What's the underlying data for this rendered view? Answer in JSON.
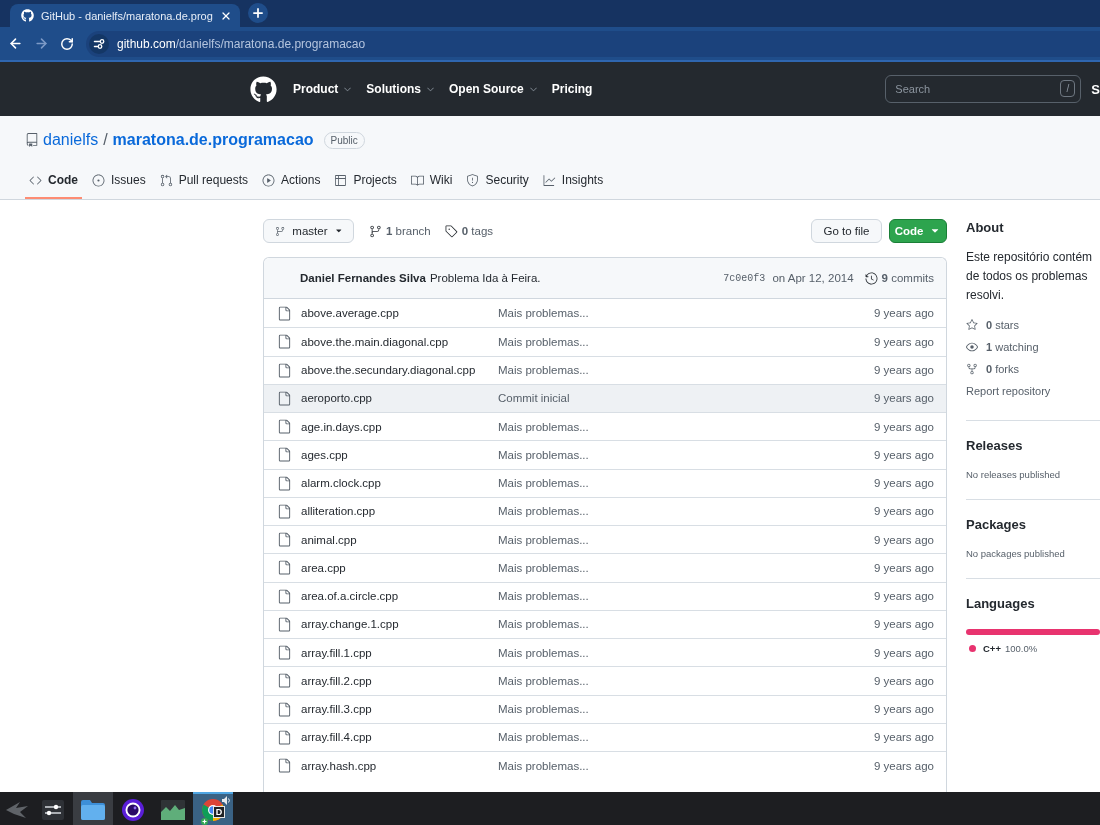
{
  "browser": {
    "tab": {
      "title": "GitHub - danielfs/maratona.de.prog"
    },
    "url": {
      "host": "github.com",
      "path": "/danielfs/maratona.de.programacao"
    }
  },
  "header": {
    "nav": [
      {
        "label": "Product",
        "has_menu": true
      },
      {
        "label": "Solutions",
        "has_menu": true
      },
      {
        "label": "Open Source",
        "has_menu": true
      },
      {
        "label": "Pricing",
        "has_menu": false
      }
    ],
    "search": {
      "placeholder": "Search",
      "shortcut": "/"
    },
    "cut_off_button": "S"
  },
  "repo": {
    "owner": "danielfs",
    "separator": "/",
    "name": "maratona.de.programacao",
    "visibility": "Public"
  },
  "tabs": [
    {
      "label": "Code",
      "selected": true
    },
    {
      "label": "Issues",
      "selected": false
    },
    {
      "label": "Pull requests",
      "selected": false
    },
    {
      "label": "Actions",
      "selected": false
    },
    {
      "label": "Projects",
      "selected": false
    },
    {
      "label": "Wiki",
      "selected": false
    },
    {
      "label": "Security",
      "selected": false
    },
    {
      "label": "Insights",
      "selected": false
    }
  ],
  "toolbar": {
    "branch": "master",
    "branches": "**1** branch",
    "tags": "**0** tags",
    "go_to_file": "Go to file",
    "code_button": "Code"
  },
  "commit": {
    "author": "Daniel Fernandes Silva",
    "message": "Problema Ida à Feira.",
    "sha": "7c0e0f3",
    "date": "on Apr 12, 2014",
    "commits": "**9** commits"
  },
  "files": [
    {
      "name": "above.average.cpp",
      "message": "Mais problemas...",
      "age": "9 years ago",
      "hovered": false
    },
    {
      "name": "above.the.main.diagonal.cpp",
      "message": "Mais problemas...",
      "age": "9 years ago",
      "hovered": false
    },
    {
      "name": "above.the.secundary.diagonal.cpp",
      "message": "Mais problemas...",
      "age": "9 years ago",
      "hovered": false
    },
    {
      "name": "aeroporto.cpp",
      "message": "Commit inicial",
      "age": "9 years ago",
      "hovered": true
    },
    {
      "name": "age.in.days.cpp",
      "message": "Mais problemas...",
      "age": "9 years ago",
      "hovered": false
    },
    {
      "name": "ages.cpp",
      "message": "Mais problemas...",
      "age": "9 years ago",
      "hovered": false
    },
    {
      "name": "alarm.clock.cpp",
      "message": "Mais problemas...",
      "age": "9 years ago",
      "hovered": false
    },
    {
      "name": "alliteration.cpp",
      "message": "Mais problemas...",
      "age": "9 years ago",
      "hovered": false
    },
    {
      "name": "animal.cpp",
      "message": "Mais problemas...",
      "age": "9 years ago",
      "hovered": false
    },
    {
      "name": "area.cpp",
      "message": "Mais problemas...",
      "age": "9 years ago",
      "hovered": false
    },
    {
      "name": "area.of.a.circle.cpp",
      "message": "Mais problemas...",
      "age": "9 years ago",
      "hovered": false
    },
    {
      "name": "array.change.1.cpp",
      "message": "Mais problemas...",
      "age": "9 years ago",
      "hovered": false
    },
    {
      "name": "array.fill.1.cpp",
      "message": "Mais problemas...",
      "age": "9 years ago",
      "hovered": false
    },
    {
      "name": "array.fill.2.cpp",
      "message": "Mais problemas...",
      "age": "9 years ago",
      "hovered": false
    },
    {
      "name": "array.fill.3.cpp",
      "message": "Mais problemas...",
      "age": "9 years ago",
      "hovered": false
    },
    {
      "name": "array.fill.4.cpp",
      "message": "Mais problemas...",
      "age": "9 years ago",
      "hovered": false
    },
    {
      "name": "array.hash.cpp",
      "message": "Mais problemas...",
      "age": "9 years ago",
      "hovered": false
    }
  ],
  "about": {
    "title": "About",
    "description_lines": [
      "Este repositório contém",
      "de todos os problemas",
      "resolvi."
    ],
    "stats": [
      "**0** stars",
      "**1** watching",
      "**0** forks"
    ],
    "report": "Report repository"
  },
  "releases": {
    "title": "Releases",
    "note": "No releases published"
  },
  "packages": {
    "title": "Packages",
    "note": "No packages published"
  },
  "languages": {
    "title": "Languages",
    "items": [
      {
        "name": "C++",
        "percent": "100.0%",
        "color": "#e8336f",
        "level": 1
      }
    ]
  },
  "taskbar": [
    {
      "kind": "wing",
      "active": false,
      "hovered": false
    },
    {
      "kind": "sliders",
      "active": false,
      "hovered": false
    },
    {
      "kind": "folder",
      "active": false,
      "hovered": true
    },
    {
      "kind": "orb",
      "active": false,
      "hovered": false
    },
    {
      "kind": "chart",
      "active": false,
      "hovered": false
    },
    {
      "kind": "browser",
      "badge": "D",
      "active": true,
      "hovered": false
    }
  ]
}
